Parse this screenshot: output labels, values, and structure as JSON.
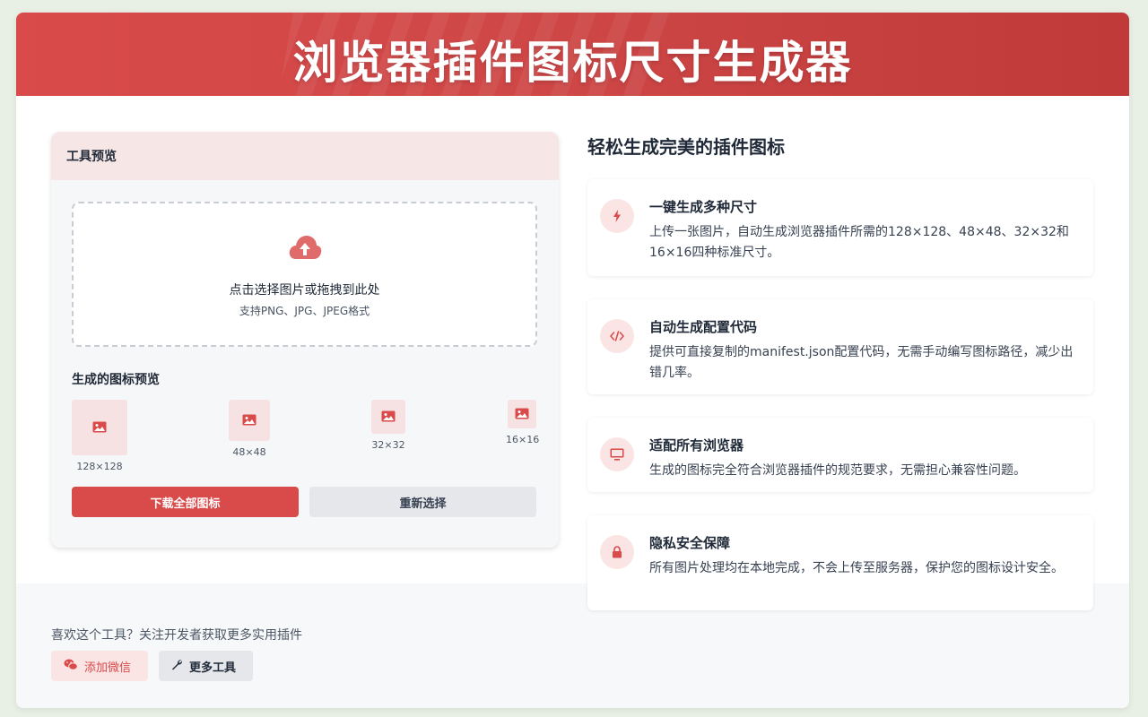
{
  "banner": {
    "title": "浏览器插件图标尺寸生成器"
  },
  "tool": {
    "header": "工具预览",
    "upload": {
      "title": "点击选择图片或拖拽到此处",
      "subtitle": "支持PNG、JPG、JPEG格式"
    },
    "preview_title": "生成的图标预览",
    "icons": [
      {
        "size": "128×128"
      },
      {
        "size": "48×48"
      },
      {
        "size": "32×32"
      },
      {
        "size": "16×16"
      }
    ],
    "download_label": "下载全部图标",
    "reselect_label": "重新选择"
  },
  "features": {
    "title": "轻松生成完美的插件图标",
    "items": [
      {
        "icon": "bolt-icon",
        "title": "一键生成多种尺寸",
        "desc": "上传一张图片，自动生成浏览器插件所需的128×128、48×48、32×32和16×16四种标准尺寸。"
      },
      {
        "icon": "code-icon",
        "title": "自动生成配置代码",
        "desc": "提供可直接复制的manifest.json配置代码，无需手动编写图标路径，减少出错几率。"
      },
      {
        "icon": "monitor-icon",
        "title": "适配所有浏览器",
        "desc": "生成的图标完全符合浏览器插件的规范要求，无需担心兼容性问题。"
      },
      {
        "icon": "lock-icon",
        "title": "隐私安全保障",
        "desc": "所有图片处理均在本地完成，不会上传至服务器，保护您的图标设计安全。"
      }
    ]
  },
  "footer": {
    "text": "喜欢这个工具？关注开发者获取更多实用插件",
    "wechat_label": "添加微信",
    "more_label": "更多工具"
  },
  "colors": {
    "accent": "#d94a4a",
    "accent_light": "#fbe4e4"
  }
}
